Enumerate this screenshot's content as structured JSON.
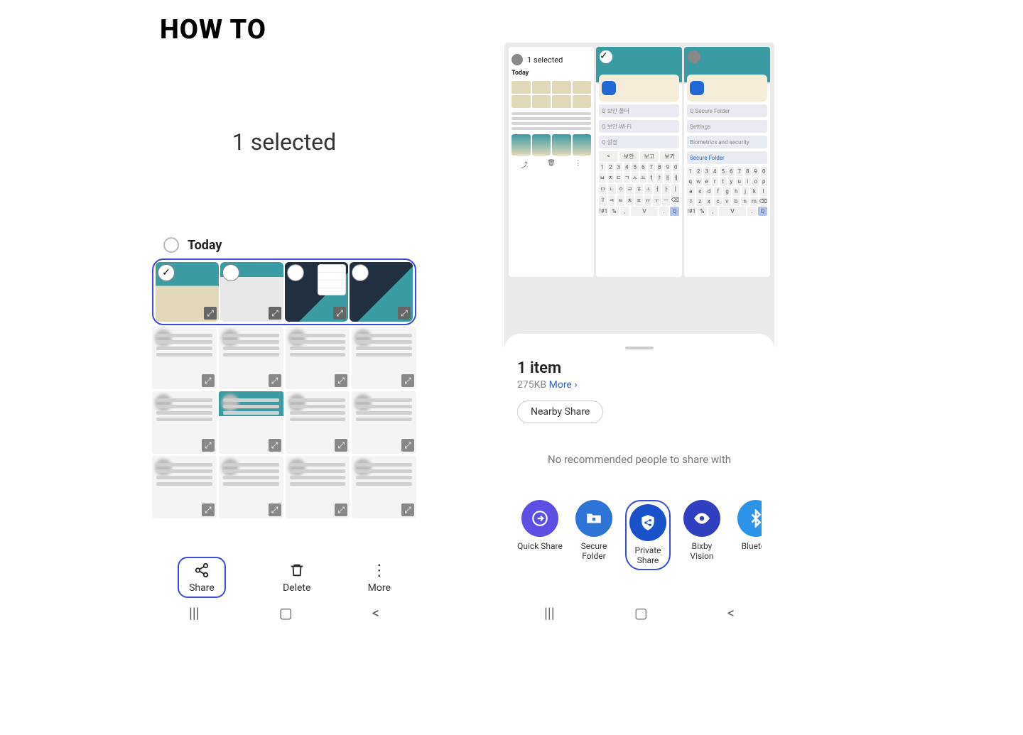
{
  "page": {
    "title": "HOW TO"
  },
  "left_phone": {
    "header": "1 selected",
    "date_label": "Today",
    "thumbs_selected_count": 1,
    "bottom_actions": {
      "share": "Share",
      "delete": "Delete",
      "more": "More"
    },
    "nav": {
      "recents": "|||",
      "home": "▢",
      "back": "<"
    }
  },
  "right_phone": {
    "gallery_header": "1 selected",
    "mini_bottom": {
      "share": "Share",
      "delete": "Delete",
      "more": "More"
    },
    "search_hint_1": "Q 보안 폴더",
    "search_hint_2": "Q 보안 Wi-Fi",
    "search_hint_3": "Q 설정",
    "search_hint_r1": "Q Secure Folder",
    "search_hint_r2": "Settings",
    "kb_tabs": {
      "a": "<",
      "b": "보안",
      "c": "보고",
      "d": "보기"
    },
    "sheet": {
      "title": "1 item",
      "size": "275KB",
      "more": "More",
      "nearby": "Nearby Share",
      "norec": "No recommended people to share with",
      "apps": [
        {
          "id": "quick-share",
          "label": "Quick Share"
        },
        {
          "id": "secure-folder",
          "label": "Secure Folder"
        },
        {
          "id": "private-share",
          "label": "Private Share"
        },
        {
          "id": "bixby-vision",
          "label": "Bixby Vision"
        },
        {
          "id": "bluetooth",
          "label": "Bluetoo"
        }
      ]
    },
    "nav": {
      "recents": "|||",
      "home": "▢",
      "back": "<"
    }
  },
  "icons": {
    "share": "share-icon",
    "delete": "trash-icon",
    "more": "more-vertical-icon",
    "checkmark": "check-icon",
    "expand": "expand-icon",
    "chevron": "chevron-right-icon",
    "quick_share": "arrow-circle-icon",
    "secure_folder": "folder-lock-icon",
    "private_share": "shield-share-icon",
    "bixby_vision": "eye-icon",
    "bluetooth": "bluetooth-icon"
  }
}
